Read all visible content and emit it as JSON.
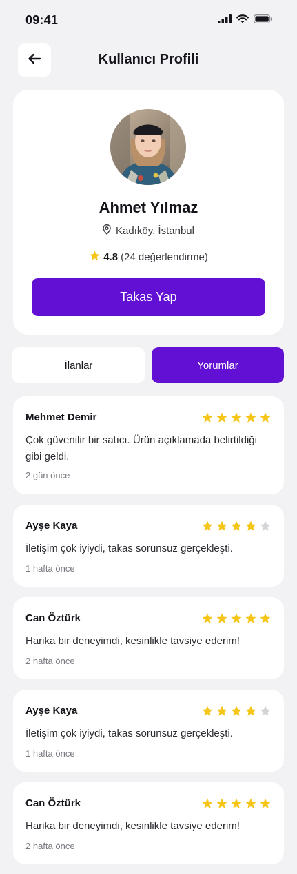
{
  "status_bar": {
    "time": "09:41"
  },
  "header": {
    "title": "Kullanıcı Profili"
  },
  "profile": {
    "name": "Ahmet Yılmaz",
    "location": "Kadıköy, İstanbul",
    "rating": "4.8",
    "rating_count": "(24 değerlendirme)",
    "trade_button": "Takas Yap"
  },
  "tabs": {
    "listings": "İlanlar",
    "reviews": "Yorumlar"
  },
  "colors": {
    "accent": "#6210d4",
    "star_filled": "#f5c518",
    "star_empty": "#d4d4d8"
  },
  "reviews": [
    {
      "name": "Mehmet Demir",
      "rating": 5,
      "text": "Çok güvenilir bir satıcı. Ürün açıklamada belirtildiği gibi geldi.",
      "time": "2 gün önce"
    },
    {
      "name": "Ayşe Kaya",
      "rating": 4,
      "text": "İletişim çok iyiydi, takas sorunsuz gerçekleşti.",
      "time": "1 hafta önce"
    },
    {
      "name": "Can Öztürk",
      "rating": 5,
      "text": "Harika bir deneyimdi, kesinlikle tavsiye ederim!",
      "time": "2 hafta önce"
    },
    {
      "name": "Ayşe Kaya",
      "rating": 4,
      "text": "İletişim çok iyiydi, takas sorunsuz gerçekleşti.",
      "time": "1 hafta önce"
    },
    {
      "name": "Can Öztürk",
      "rating": 5,
      "text": "Harika bir deneyimdi, kesinlikle tavsiye ederim!",
      "time": "2 hafta önce"
    }
  ]
}
